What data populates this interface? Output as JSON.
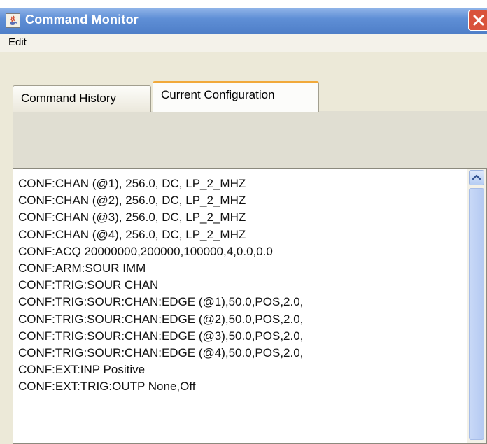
{
  "window": {
    "title": "Command Monitor",
    "icon": "java-cup-icon",
    "close_icon": "close-icon"
  },
  "menu": {
    "items": [
      {
        "label": "Edit"
      }
    ]
  },
  "tabs": [
    {
      "label": "Command History",
      "selected": false
    },
    {
      "label": "Current Configuration",
      "selected": true
    }
  ],
  "config_lines": [
    "CONF:CHAN (@1), 256.0, DC, LP_2_MHZ",
    "CONF:CHAN (@2), 256.0, DC, LP_2_MHZ",
    "CONF:CHAN (@3), 256.0, DC, LP_2_MHZ",
    "CONF:CHAN (@4), 256.0, DC, LP_2_MHZ",
    "CONF:ACQ 20000000,200000,100000,4,0.0,0.0",
    "CONF:ARM:SOUR IMM",
    "CONF:TRIG:SOUR CHAN",
    "CONF:TRIG:SOUR:CHAN:EDGE (@1),50.0,POS,2.0,",
    "CONF:TRIG:SOUR:CHAN:EDGE (@2),50.0,POS,2.0,",
    "CONF:TRIG:SOUR:CHAN:EDGE (@3),50.0,POS,2.0,",
    "CONF:TRIG:SOUR:CHAN:EDGE (@4),50.0,POS,2.0,",
    "CONF:EXT:INP Positive",
    "CONF:EXT:TRIG:OUTP None,Off"
  ],
  "scrollbar": {
    "up_icon": "scroll-up-arrow-icon"
  },
  "colors": {
    "titlebar": "#5f8fd6",
    "close_button": "#d9533c",
    "selected_tab_accent": "#f1a93a"
  }
}
